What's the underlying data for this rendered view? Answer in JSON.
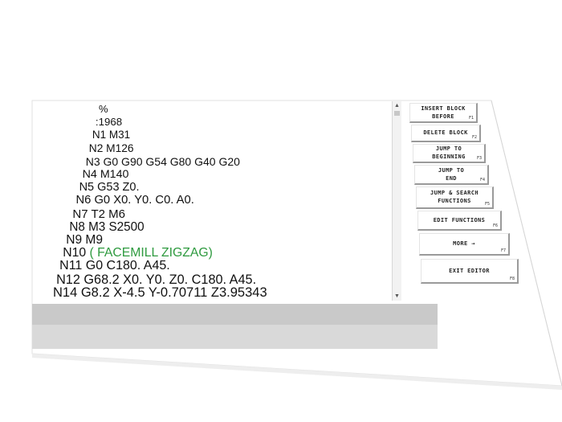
{
  "program": {
    "lines": [
      {
        "text": "%"
      },
      {
        "text": ":1968"
      },
      {
        "text": "N1 M31"
      },
      {
        "text": "N2 M126"
      },
      {
        "text": "N3 G0 G90 G54 G80 G40 G20"
      },
      {
        "text": "N4 M140"
      },
      {
        "text": "N5 G53 Z0."
      },
      {
        "text": "N6 G0 X0. Y0. C0. A0."
      },
      {
        "text": "N7 T2 M6"
      },
      {
        "text": "N8 M3 S2500"
      },
      {
        "text": "N9 M9"
      },
      {
        "text": "N10 ",
        "comment": "( FACEMILL ZIGZAG)"
      },
      {
        "text": "N11 G0 C180. A45."
      },
      {
        "text": "N12 G68.2 X0. Y0. Z0. C180. A45."
      },
      {
        "text": "N14 G8.2 X-4.5 Y-0.70711 Z3.95343"
      }
    ],
    "comment_color": "#2e9a3f"
  },
  "function_keys": [
    {
      "lines": [
        "INSERT BLOCK",
        "BEFORE"
      ],
      "key": "F1"
    },
    {
      "lines": [
        "DELETE BLOCK"
      ],
      "key": "F2"
    },
    {
      "lines": [
        "JUMP TO",
        "BEGINNING"
      ],
      "key": "F3"
    },
    {
      "lines": [
        "JUMP TO",
        "END"
      ],
      "key": "F4"
    },
    {
      "lines": [
        "JUMP & SEARCH",
        "FUNCTIONS"
      ],
      "key": "F5"
    },
    {
      "lines": [
        "EDIT FUNCTIONS"
      ],
      "key": "F6"
    },
    {
      "lines": [
        "MORE →"
      ],
      "key": "F7"
    },
    {
      "lines": [
        "EXIT EDITOR"
      ],
      "key": "F8"
    }
  ],
  "icons": {
    "scroll_up": "scroll-up-arrow-icon",
    "scroll_down": "scroll-down-arrow-icon"
  },
  "colors": {
    "status_bar_1": "#c9c9c9",
    "status_bar_2": "#d9d9d9"
  }
}
